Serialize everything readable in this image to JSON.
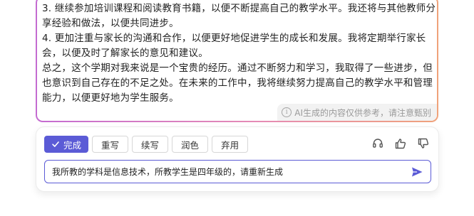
{
  "document": {
    "paragraphs": [
      "3. 继续参加培训课程和阅读教育书籍，以便不断提高自己的教学水平。我还将与其他教师分享经验和做法，以便共同进步。",
      "4. 更加注重与家长的沟通和合作，以便更好地促进学生的成长和发展。我将定期举行家长会，以便及时了解家长的意见和建议。",
      "总之，这个学期对我来说是一个宝贵的经历。通过不断努力和学习，我取得了一些进步，但也意识到自己存在的不足之处。在未来的工作中，我将继续努力提高自己的教学水平和管理能力，以便更好地为学生服务。"
    ],
    "disclaimer": "AI生成的内容仅供参考，请注意甄别",
    "info_icon": "info-icon"
  },
  "toolbar": {
    "done_label": "完成",
    "rewrite_label": "重写",
    "continue_label": "续写",
    "polish_label": "润色",
    "discard_label": "弃用"
  },
  "feedback": {
    "icons": [
      "headset-icon",
      "thumbs-up-icon",
      "thumbs-down-icon"
    ]
  },
  "input": {
    "value": "我所教的学科是信息技术，所教学生是四年级的，请重新生成",
    "send_icon": "send-icon"
  },
  "colors": {
    "accent": "#5b5bd6",
    "border_gradient_start": "#c46bd1",
    "border_gradient_end": "#f0a27a"
  }
}
